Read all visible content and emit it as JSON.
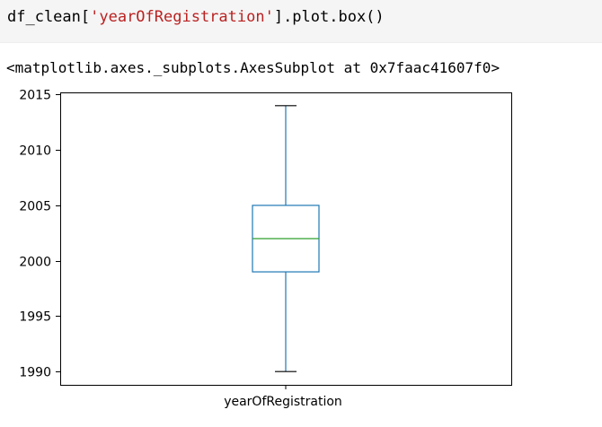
{
  "code_cell": {
    "prefix": "df_clean[",
    "string_arg": "'yearOfRegistration'",
    "suffix": "].plot.box()"
  },
  "output_text": "<matplotlib.axes._subplots.AxesSubplot at 0x7faac41607f0>",
  "colors": {
    "box": "#1f77b4",
    "median": "#2ca02c",
    "string": "#ba2121"
  },
  "chart_data": {
    "type": "box",
    "title": "",
    "xlabel": "",
    "ylabel": "",
    "categories": [
      "yearOfRegistration"
    ],
    "ylim": [
      1988.8,
      2015.2
    ],
    "yticks": [
      1990,
      1995,
      2000,
      2005,
      2010,
      2015
    ],
    "boxes": [
      {
        "name": "yearOfRegistration",
        "whisker_low": 1990,
        "q1": 1999,
        "median": 2002,
        "q3": 2005,
        "whisker_high": 2014
      }
    ],
    "grid": false
  }
}
